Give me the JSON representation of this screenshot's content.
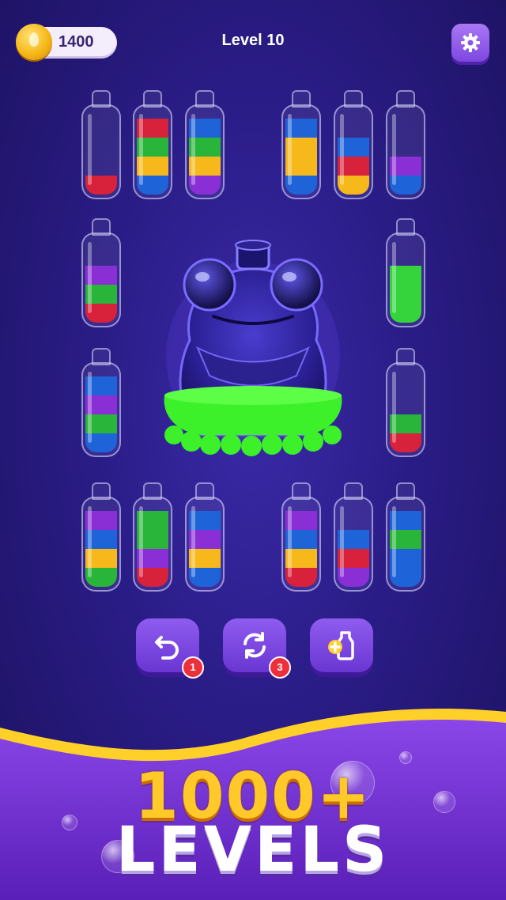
{
  "header": {
    "coins": "1400",
    "level_title": "Level 10",
    "settings_icon": "gear-icon"
  },
  "colors": {
    "red": "#d8213a",
    "green": "#28b53a",
    "yellow": "#f6b81a",
    "blue": "#1f63d9",
    "purple": "#8a2fd6",
    "lightgreen": "#35d33c"
  },
  "bottles": [
    {
      "id": "top-left-1",
      "layers": [
        "red"
      ]
    },
    {
      "id": "top-left-2",
      "layers": [
        "blue",
        "yellow",
        "green",
        "red"
      ]
    },
    {
      "id": "top-left-3",
      "layers": [
        "purple",
        "yellow",
        "green",
        "blue"
      ]
    },
    {
      "id": "top-right-1",
      "layers": [
        "blue",
        "yellow",
        "yellow",
        "blue"
      ]
    },
    {
      "id": "top-right-2",
      "layers": [
        "yellow",
        "red",
        "blue"
      ]
    },
    {
      "id": "top-right-3",
      "layers": [
        "blue",
        "purple"
      ]
    },
    {
      "id": "mid-left-1",
      "layers": [
        "red",
        "green",
        "purple"
      ]
    },
    {
      "id": "mid-right-1",
      "layers": [
        "lightgreen",
        "lightgreen",
        "lightgreen"
      ]
    },
    {
      "id": "mid-left-2",
      "layers": [
        "blue",
        "green",
        "purple",
        "blue"
      ]
    },
    {
      "id": "mid-right-2",
      "layers": [
        "red",
        "green"
      ]
    },
    {
      "id": "bot-left-1",
      "layers": [
        "green",
        "yellow",
        "blue",
        "purple"
      ]
    },
    {
      "id": "bot-left-2",
      "layers": [
        "red",
        "purple",
        "green",
        "green"
      ]
    },
    {
      "id": "bot-left-3",
      "layers": [
        "blue",
        "yellow",
        "purple",
        "blue"
      ]
    },
    {
      "id": "bot-right-1",
      "layers": [
        "red",
        "yellow",
        "blue",
        "purple"
      ]
    },
    {
      "id": "bot-right-2",
      "layers": [
        "purple",
        "red",
        "blue"
      ]
    },
    {
      "id": "bot-right-3",
      "layers": [
        "blue",
        "blue",
        "green",
        "blue"
      ]
    }
  ],
  "center_figure": {
    "icon": "frog-jar-icon",
    "fill": "#3cf02a"
  },
  "tools": [
    {
      "name": "undo",
      "icon": "undo-icon",
      "count": "1"
    },
    {
      "name": "restart",
      "icon": "restart-icon",
      "count": "3"
    },
    {
      "name": "add-bottle",
      "icon": "add-bottle-icon",
      "count": ""
    }
  ],
  "promo": {
    "number": "1000+",
    "word": "LEVELS"
  }
}
